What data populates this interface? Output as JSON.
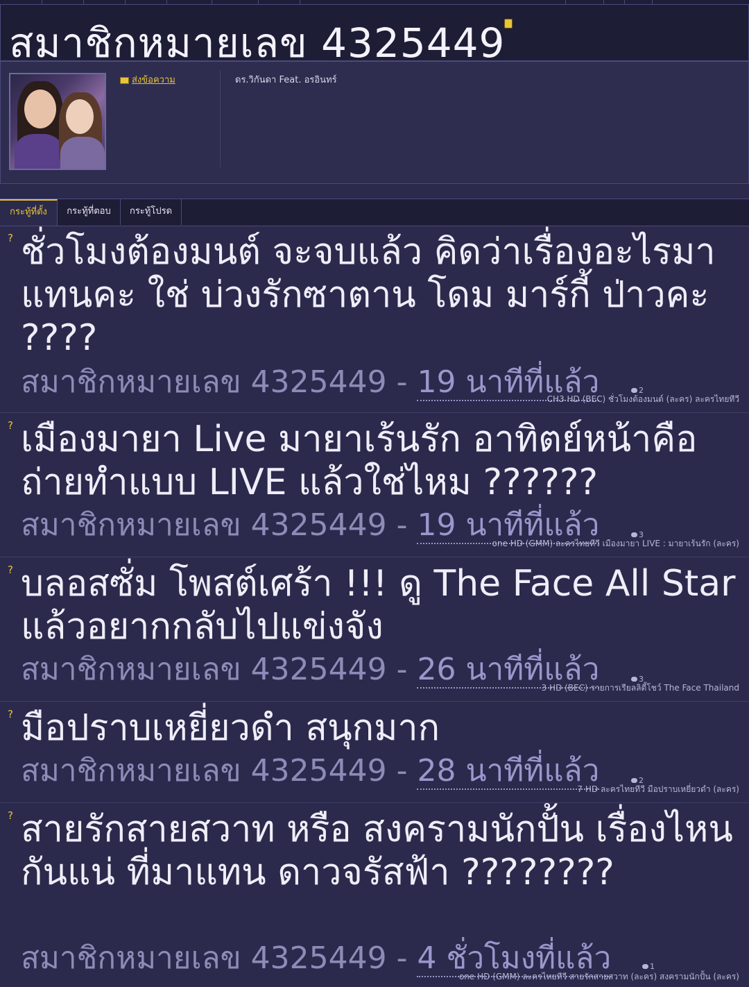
{
  "header": {
    "title": "สมาชิกหมายเลข 4325449"
  },
  "profile": {
    "send_message_label": "ส่งข้อความ",
    "signature": "ดร.วิกันดา Feat. อรอินทร์"
  },
  "tabs": [
    {
      "label": "กระทู้ที่ตั้ง",
      "active": true
    },
    {
      "label": "กระทู้ที่ตอบ",
      "active": false
    },
    {
      "label": "กระทู้โปรด",
      "active": false
    }
  ],
  "topics": [
    {
      "title": "ชั่วโมงต้องมนต์ จะจบแล้ว คิดว่าเรื่องอะไรมาแทนคะ ใช่ บ่วงรักซาตาน โดม มาร์กี้ ป่าวคะ ????",
      "author": "สมาชิกหมายเลข 4325449",
      "separator": "-",
      "time": "19 นาทีที่แล้ว",
      "comments": "2",
      "tags": "CH3 HD (BEC)  ชั่วโมงต้องมนต์ (ละคร)  ละครไทยทีวี"
    },
    {
      "title": "เมืองมายา Live มายาเร้นรัก อาทิตย์หน้าคือถ่ายทำแบบ LIVE แล้วใช่ไหม ??????",
      "author": "สมาชิกหมายเลข 4325449",
      "separator": "-",
      "time": "19 นาทีที่แล้ว",
      "comments": "3",
      "tags": "one HD (GMM)  ละครไทยทีวี  เมืองมายา LIVE : มายาเร้นรัก (ละคร)"
    },
    {
      "title": "บลอสซั่ม โพสต์เศร้า !!! ดู The Face All Star แล้วอยากกลับไปแข่งจัง",
      "author": "สมาชิกหมายเลข 4325449",
      "separator": "-",
      "time": "26 นาทีที่แล้ว",
      "comments": "3",
      "tags": "3 HD (BEC)  รายการเรียลลิตี้โชว์  The Face Thailand"
    },
    {
      "title": "มือปราบเหยี่ยวดำ สนุกมาก",
      "author": "สมาชิกหมายเลข 4325449",
      "separator": "-",
      "time": "28 นาทีที่แล้ว",
      "comments": "2",
      "tags": "7 HD  ละครไทยทีวี  มือปราบเหยี่ยวดำ (ละคร)"
    },
    {
      "title": "สายรักสายสวาท หรือ สงครามนักปั้น เรื่องไหนกันแน่ ที่มาแทน ดาวจรัสฟ้า ????????",
      "author": "สมาชิกหมายเลข 4325449",
      "separator": "-",
      "time": "4 ชั่วโมงที่แล้ว",
      "comments": "1",
      "tags": "one HD (GMM)  ละครไทยทีวี  สายรักสายสวาท (ละคร)  สงครามนักปั้น (ละคร)"
    }
  ],
  "colors": {
    "background": "#2b2a4c",
    "accent": "#e8c43a",
    "meta": "#8e8bb8"
  }
}
